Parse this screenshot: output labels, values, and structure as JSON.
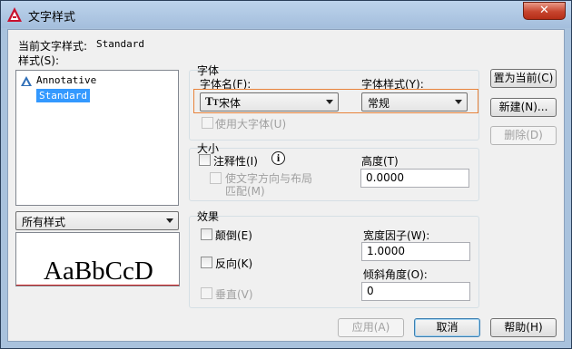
{
  "window": {
    "title": "文字样式",
    "close_label": "✕"
  },
  "current_style": {
    "label": "当前文字样式:",
    "value": "Standard"
  },
  "styles": {
    "label": "样式(S):",
    "items": [
      "Annotative",
      "Standard"
    ],
    "selected": "Standard",
    "filter_value": "所有样式"
  },
  "preview": {
    "sample_text": "AaBbCcD"
  },
  "font": {
    "group_title": "字体",
    "name_label": "字体名(F):",
    "name_value": "宋体",
    "style_label": "字体样式(Y):",
    "style_value": "常规",
    "bigfont_label": "使用大字体(U)"
  },
  "size": {
    "group_title": "大小",
    "annotative_label": "注释性(I)",
    "match_line1": "使文字方向与布局",
    "match_line2": "匹配(M)",
    "height_label": "高度(T)",
    "height_value": "0.0000"
  },
  "effects": {
    "group_title": "效果",
    "upside_down_label": "颠倒(E)",
    "backwards_label": "反向(K)",
    "vertical_label": "垂直(V)",
    "width_label": "宽度因子(W):",
    "width_value": "1.0000",
    "oblique_label": "倾斜角度(O):",
    "oblique_value": "0"
  },
  "buttons": {
    "set_current": "置为当前(C)",
    "new": "新建(N)...",
    "delete": "删除(D)",
    "apply": "应用(A)",
    "cancel": "取消",
    "help": "帮助(H)"
  },
  "colors": {
    "selection": "#3399ff",
    "highlight_border": "#e8823a",
    "baseline": "#cc2222"
  }
}
